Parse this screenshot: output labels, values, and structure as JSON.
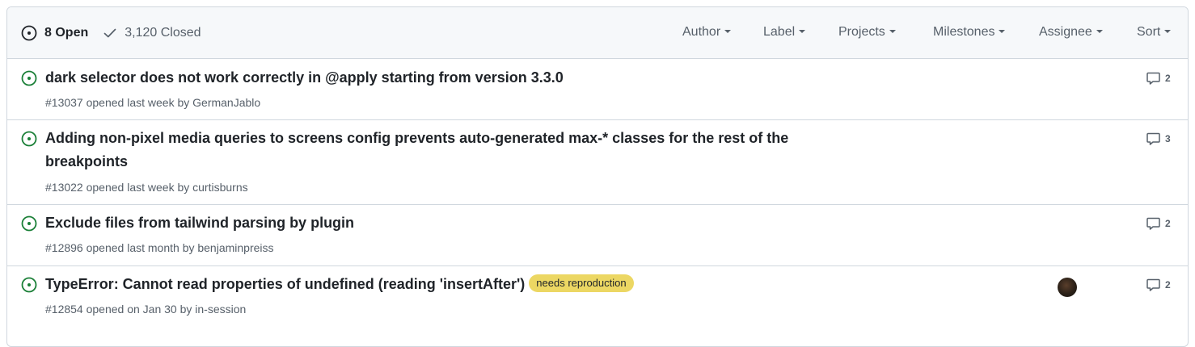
{
  "header": {
    "open_count": "8 Open",
    "closed_count": "3,120 Closed",
    "filters": [
      {
        "label": "Author"
      },
      {
        "label": "Label"
      },
      {
        "label": "Projects"
      },
      {
        "label": "Milestones"
      },
      {
        "label": "Assignee"
      },
      {
        "label": "Sort"
      }
    ]
  },
  "issues": [
    {
      "title": "dark selector does not work correctly in @apply starting from version 3.3.0",
      "meta": "#13037 opened last week by GermanJablo",
      "comments": "2"
    },
    {
      "title_line1": "Adding non-pixel media queries to screens config prevents auto-generated max-* classes for the rest of the",
      "title_line2": "breakpoints",
      "meta": "#13022 opened last week by curtisburns",
      "comments": "3"
    },
    {
      "title": "Exclude files from tailwind parsing by plugin",
      "meta": "#12896 opened last month by benjaminpreiss",
      "comments": "2"
    },
    {
      "title": "TypeError: Cannot read properties of undefined (reading 'insertAfter')",
      "label": "needs reproduction",
      "meta": "#12854 opened on Jan 30 by in-session",
      "comments": "2"
    }
  ],
  "colors": {
    "open_icon": "#1a7f37",
    "label_bg": "#ecd763",
    "muted_text": "#57606a",
    "border": "#d0d7de"
  }
}
